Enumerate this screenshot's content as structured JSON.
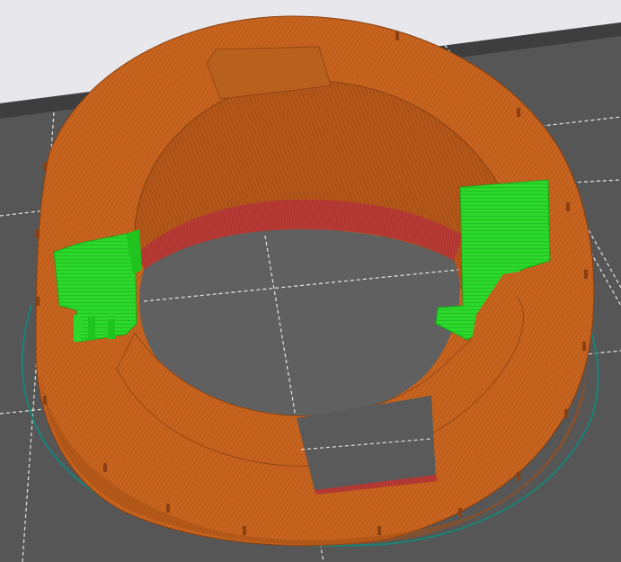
{
  "viewport": {
    "kind": "3d-slicer-preview",
    "background_color": "#4a4a4a",
    "bed_color": "#5a5a5a",
    "top_band_color": "#e8e8ec",
    "gridline_color": "#ffffff",
    "gridline_style": "dashed"
  },
  "model": {
    "shape": "hemispherical-ring-with-cutouts",
    "extrusion_roles": {
      "perimeter": "#c8641e",
      "perimeter_shade": "#a9521a",
      "overhang": "#b83a35",
      "support": "#2bd92b",
      "skirt": "#1f7f73"
    },
    "supports_visible": 2,
    "skirt_visible": true
  }
}
